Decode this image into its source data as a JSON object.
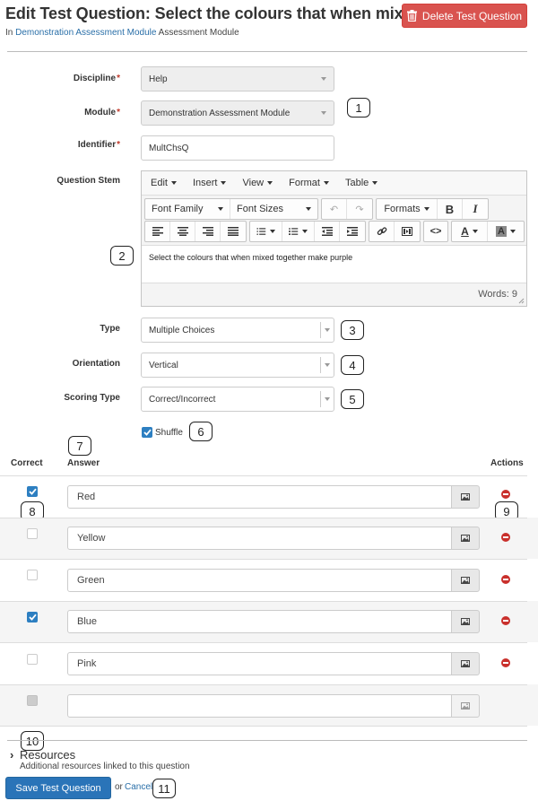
{
  "header": {
    "title": "Edit Test Question: Select the colours that when mixed…",
    "breadcrumb_prefix": "In",
    "breadcrumb_link": "Demonstration Assessment Module",
    "breadcrumb_suffix": "Assessment Module",
    "delete_label": "Delete Test Question",
    "delete_color": "#d9534f"
  },
  "form": {
    "discipline": {
      "label": "Discipline",
      "required_mark": "*",
      "value": "Help"
    },
    "module": {
      "label": "Module",
      "required_mark": "*",
      "value": "Demonstration Assessment Module"
    },
    "identifier": {
      "label": "Identifier",
      "required_mark": "*",
      "value": "MultChsQ"
    },
    "question_stem": {
      "label": "Question Stem"
    },
    "type": {
      "label": "Type",
      "value": "Multiple Choices"
    },
    "orientation": {
      "label": "Orientation",
      "value": "Vertical"
    },
    "scoring_type": {
      "label": "Scoring Type",
      "value": "Correct/Incorrect"
    },
    "shuffle": {
      "label": "Shuffle",
      "checked": true
    }
  },
  "editor": {
    "menus": [
      "Edit",
      "Insert",
      "View",
      "Format",
      "Table"
    ],
    "font_family": "Font Family",
    "font_sizes": "Font Sizes",
    "formats": "Formats",
    "bold": "B",
    "italic": "I",
    "content": "Select the colours that when mixed together make purple",
    "word_count": "Words: 9"
  },
  "answers": {
    "col_correct": "Correct",
    "col_answer": "Answer",
    "col_actions": "Actions",
    "rows": [
      {
        "text": "Red",
        "correct": true
      },
      {
        "text": "Yellow",
        "correct": false
      },
      {
        "text": "Green",
        "correct": false
      },
      {
        "text": "Blue",
        "correct": true
      },
      {
        "text": "Pink",
        "correct": false
      },
      {
        "text": "",
        "correct": null
      }
    ]
  },
  "callouts": [
    "1",
    "2",
    "3",
    "4",
    "5",
    "6",
    "7",
    "8",
    "9",
    "10",
    "11"
  ],
  "resources": {
    "title": "Resources",
    "description": "Additional resources linked to this question"
  },
  "footer": {
    "save_label": "Save Test Question",
    "or_text": "or",
    "cancel_label": "Cancel",
    "save_color": "#2a74b8"
  }
}
